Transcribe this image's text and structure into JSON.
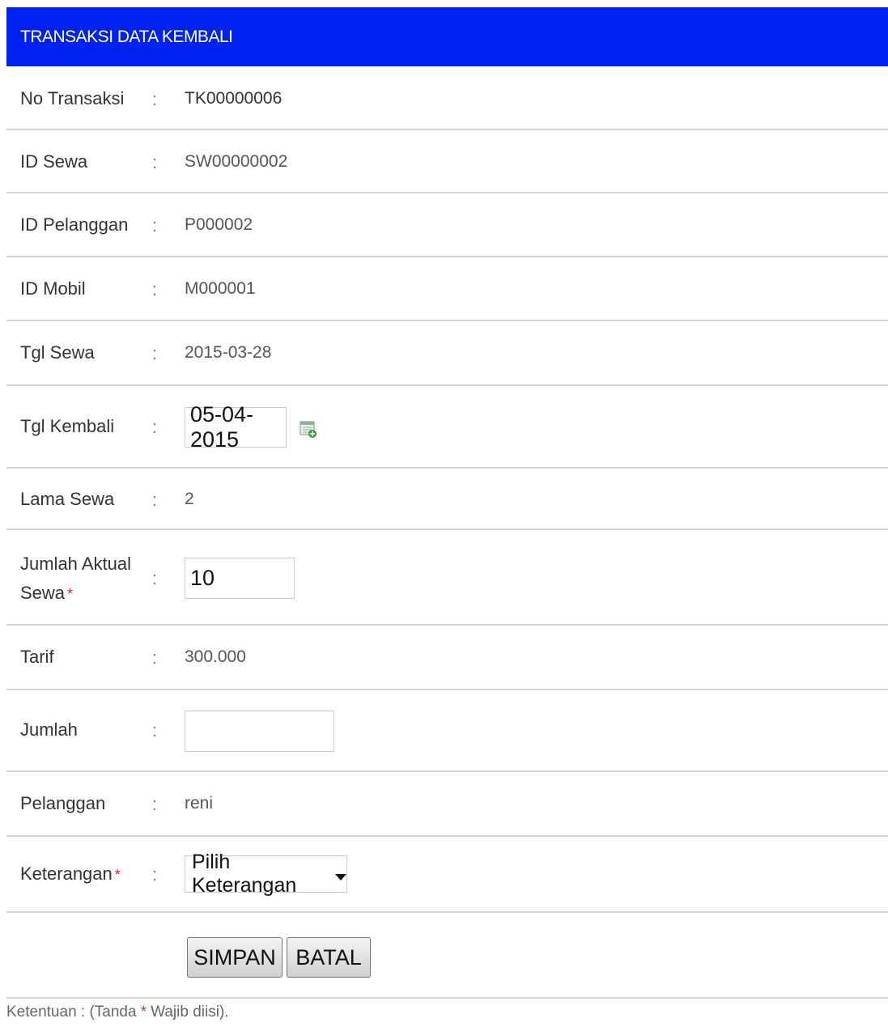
{
  "header": {
    "title": "TRANSAKSI DATA KEMBALI"
  },
  "separator": ":",
  "required_marker": "*",
  "fields": {
    "no_transaksi": {
      "label": "No Transaksi",
      "value": "TK00000006"
    },
    "id_sewa": {
      "label": "ID Sewa",
      "value": "SW00000002"
    },
    "id_pelanggan": {
      "label": "ID Pelanggan",
      "value": "P000002"
    },
    "id_mobil": {
      "label": "ID Mobil",
      "value": "M000001"
    },
    "tgl_sewa": {
      "label": "Tgl Sewa",
      "value": "2015-03-28"
    },
    "tgl_kembali": {
      "label": "Tgl Kembali",
      "value": "05-04-2015",
      "icon": "calendar-icon"
    },
    "lama_sewa": {
      "label": "Lama Sewa",
      "value": "2"
    },
    "jumlah_aktual_sewa": {
      "label_line1": "Jumlah Aktual",
      "label_line2": "Sewa",
      "value": "10",
      "required": true
    },
    "tarif": {
      "label": "Tarif",
      "value": "300.000"
    },
    "jumlah": {
      "label": "Jumlah",
      "value": ""
    },
    "pelanggan": {
      "label": "Pelanggan",
      "value": "reni"
    },
    "keterangan": {
      "label": "Keterangan",
      "selected": "Pilih Keterangan",
      "required": true
    }
  },
  "buttons": {
    "simpan": "SIMPAN",
    "batal": "BATAL"
  },
  "footer": {
    "prefix": "Ketentuan : (Tanda ",
    "suffix": " Wajib diisi)."
  }
}
